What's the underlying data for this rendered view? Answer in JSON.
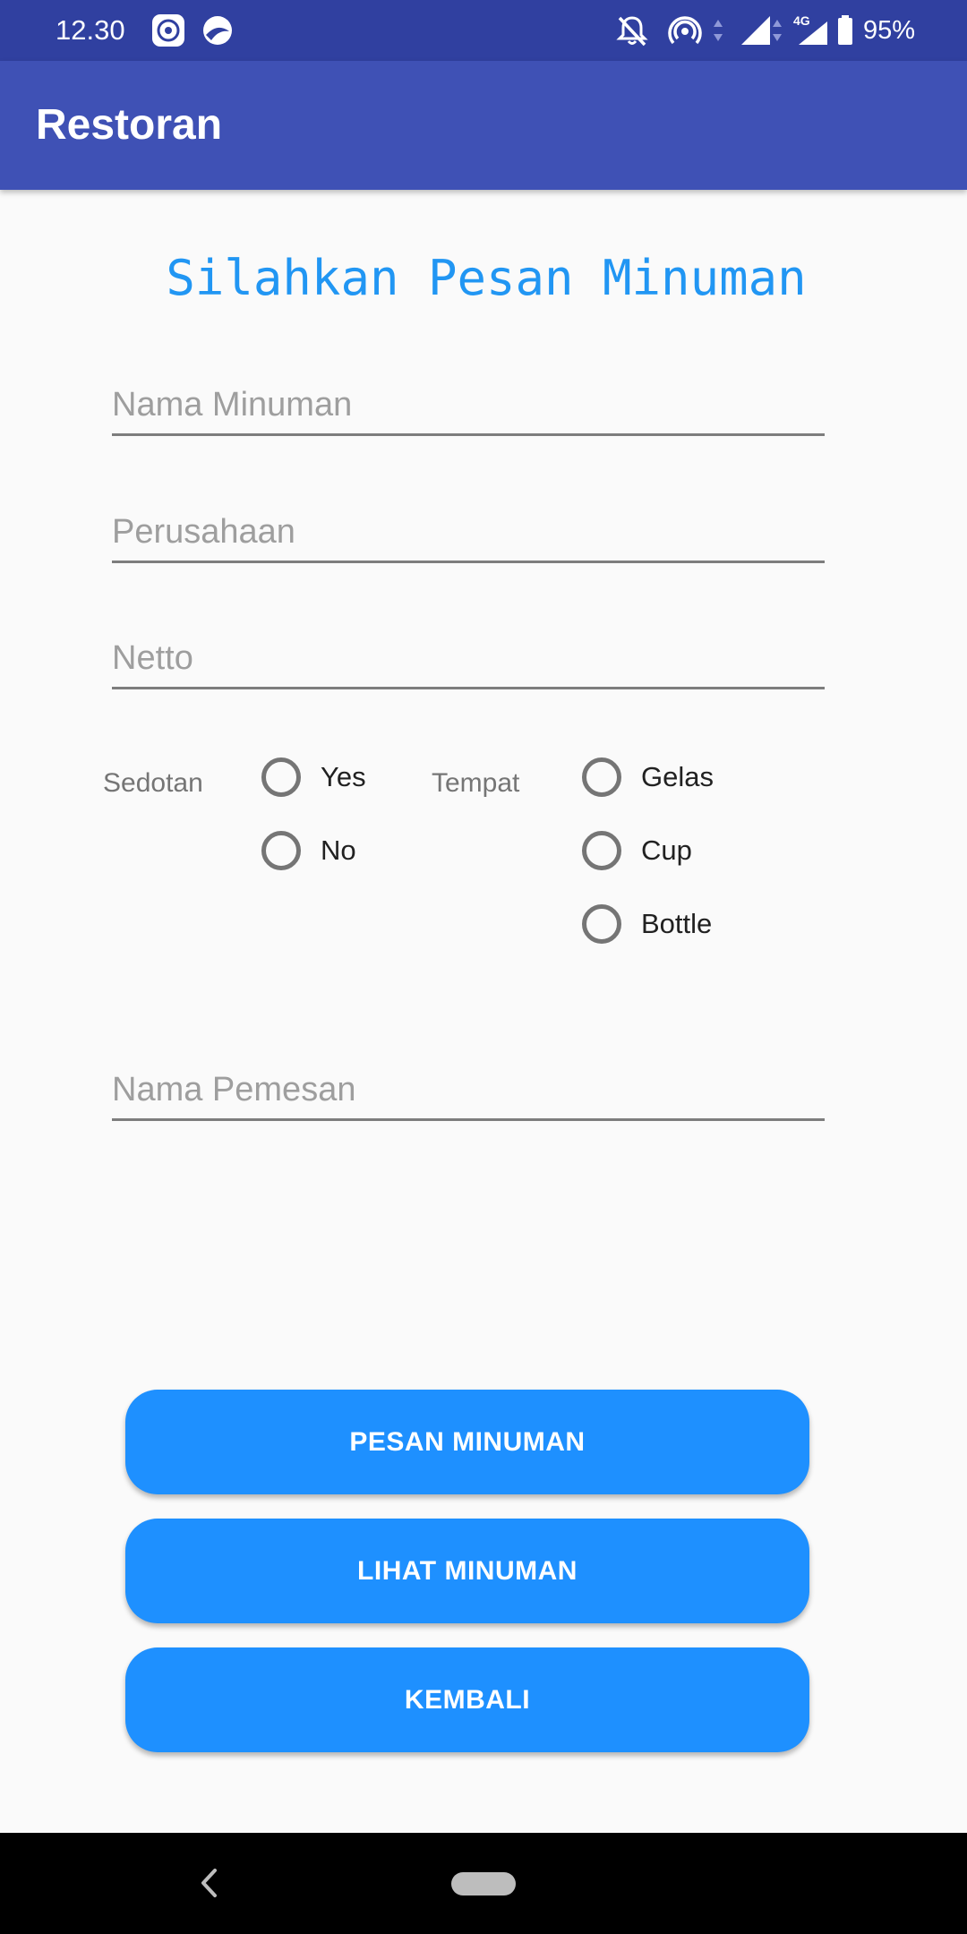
{
  "status_bar": {
    "time": "12.30",
    "network": "4G",
    "battery": "95%",
    "icons": [
      "app-notification-icon",
      "browser-notification-icon",
      "notifications-off-icon",
      "hotspot-icon",
      "signal-icon",
      "signal-4g-icon",
      "battery-icon"
    ]
  },
  "app_bar": {
    "title": "Restoran"
  },
  "form": {
    "heading": "Silahkan Pesan Minuman",
    "nama_minuman": {
      "placeholder": "Nama Minuman",
      "value": ""
    },
    "perusahaan": {
      "placeholder": "Perusahaan",
      "value": ""
    },
    "netto": {
      "placeholder": "Netto",
      "value": ""
    },
    "sedotan": {
      "label": "Sedotan",
      "options": [
        "Yes",
        "No"
      ],
      "selected": null
    },
    "tempat": {
      "label": "Tempat",
      "options": [
        "Gelas",
        "Cup",
        "Bottle"
      ],
      "selected": null
    },
    "nama_pemesan": {
      "placeholder": "Nama Pemesan",
      "value": ""
    }
  },
  "buttons": {
    "pesan": "PESAN MINUMAN",
    "lihat": "LIHAT MINUMAN",
    "kembali": "KEMBALI"
  },
  "colors": {
    "status_bar": "#3040a0",
    "app_bar": "#3f51b5",
    "accent": "#2196f3",
    "button": "#1e90ff"
  }
}
